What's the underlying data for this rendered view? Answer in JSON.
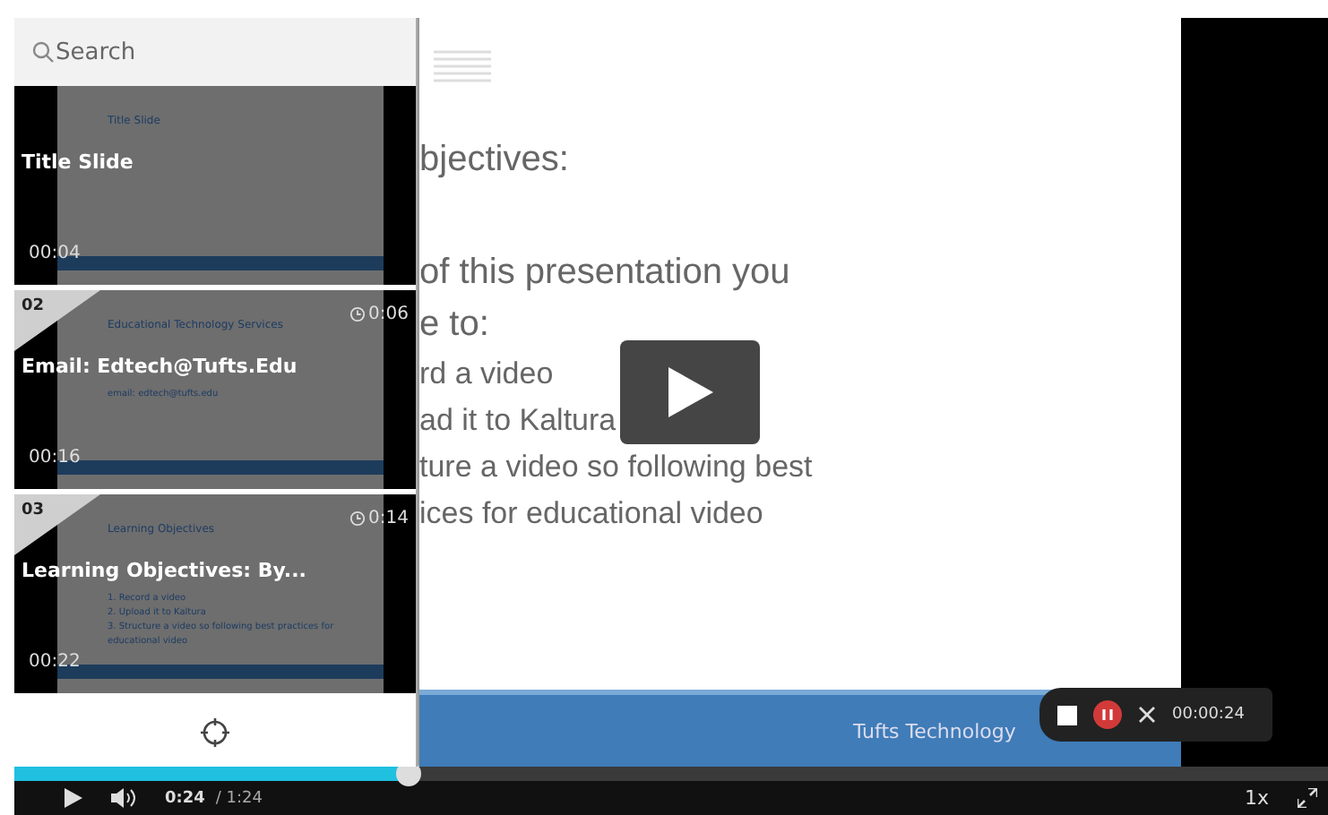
{
  "sidebar": {
    "search": {
      "placeholder": "Search"
    },
    "slides": [
      {
        "title": "Title Slide",
        "start": "00:04",
        "content": [
          "Title Slide"
        ]
      },
      {
        "number": "02",
        "duration": "0:06",
        "title": "Email: Edtech@Tufts.Edu",
        "start": "00:16",
        "content": [
          "Educational Technology Services",
          "email: edtech@tufts.edu"
        ]
      },
      {
        "number": "03",
        "duration": "0:14",
        "title": "Learning Objectives:  By...",
        "start": "00:22",
        "content": [
          "Learning Objectives",
          "1. Record a video",
          "2. Upload it to Kaltura",
          "3. Structure a video so following best practices for educational video"
        ]
      }
    ]
  },
  "slide": {
    "heading": "bjectives:",
    "lines": [
      "of this presentation you",
      "e to:",
      "rd a video",
      "ad it to Kaltura",
      "ture a video so following best",
      "ices for educational video"
    ],
    "footer": "Tufts Technology"
  },
  "recorder": {
    "time": "00:00:24"
  },
  "controls": {
    "progress": {
      "level": 0.3
    },
    "current": "0:24",
    "total": "/ 1:24",
    "speed": "1x"
  }
}
